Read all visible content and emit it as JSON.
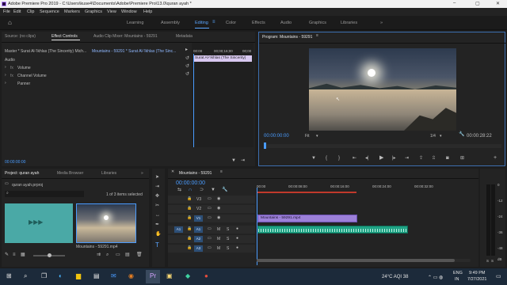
{
  "window": {
    "title": "Adobe Premiere Pro 2019 - C:\\Users\\kuse4\\Documents\\Adobe\\Premiere Pro\\13.0\\quran ayah *"
  },
  "menu": [
    "File",
    "Edit",
    "Clip",
    "Sequence",
    "Markers",
    "Graphics",
    "View",
    "Window",
    "Help"
  ],
  "workspaces": [
    "Learning",
    "Assembly",
    "Editing",
    "Color",
    "Effects",
    "Audio",
    "Graphics",
    "Libraries"
  ],
  "workspace_more": "»",
  "source_panel": {
    "tabs": [
      "Source: (no clips)",
      "Effect Controls",
      "Audio Clip Mixer: Mountains - 59291",
      "Metadata"
    ],
    "breadcrumb": "Master * Surat Al-'Ikhlas (The Sincerity) Mich...",
    "sequence_path": "Mountains - 59291 * Surat Al-'Ikhlas (The Sinc...",
    "mini_timecodes": [
      "00:00",
      "00;00;16;00",
      "00;00"
    ],
    "clip_label": "Surat Al-'Ikhlas (The Sincerity)",
    "section": "Audio",
    "params": [
      "Volume",
      "Channel Volume",
      "Panner"
    ],
    "timecode": "00:00:00:00"
  },
  "program_monitor": {
    "tab": "Program: Mountains - 59291",
    "timecode": "00:00:00:00",
    "fit": "Fit",
    "ratio": "1/4",
    "duration": "00:00:28:22"
  },
  "project_panel": {
    "tabs": [
      "Project: quran ayah",
      "Media Browser",
      "Libraries"
    ],
    "file": "quran ayah.prproj",
    "selection": "1 of 3 items selected",
    "items": [
      "",
      "Mountains - 59291.mp4"
    ],
    "more": "»"
  },
  "timeline": {
    "tab": "Mountains - 59291",
    "timecode": "00:00:00:00",
    "ruler": [
      "00:00",
      "00:00:08:00",
      "00:00:16:00",
      "00:00:24:00",
      "00:00:32:00"
    ],
    "video_tracks": [
      "V3",
      "V2",
      "V1"
    ],
    "audio_tracks": [
      "A1",
      "A2",
      "A3"
    ],
    "targets": [
      "V1",
      "A1"
    ],
    "video_clip": "Mountains - 59291.mp4",
    "meter_labels": [
      "0",
      "-12",
      "-24",
      "-36",
      "-48"
    ],
    "meter_bottom": "dB",
    "meter_solo": [
      "S",
      "S"
    ]
  },
  "taskbar": {
    "weather": "24°C AQI 38",
    "lang": [
      "ENG",
      "IN"
    ],
    "time": "9:49 PM",
    "date": "7/27/2021"
  },
  "colors": {
    "accent": "#4a9cff",
    "clip_video": "#9c80d8",
    "clip_audio": "#1fa385"
  }
}
